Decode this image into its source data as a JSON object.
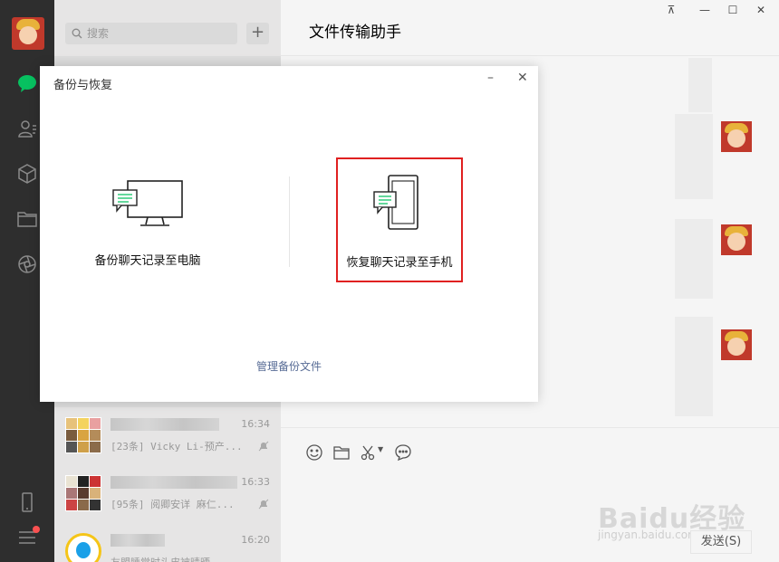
{
  "search": {
    "placeholder": "搜索"
  },
  "add_button": "+",
  "chat_title": "文件传输助手",
  "window_buttons": {
    "pin": "⊼",
    "minimize": "—",
    "maximize": "☐",
    "close": "✕"
  },
  "chat_list": [
    {
      "time": "16:34",
      "preview": "[23条] Vicky Li-预产..."
    },
    {
      "time": "16:33",
      "preview": "[95条] 阅卿安详  麻仁..."
    },
    {
      "time": "16:20",
      "preview": "友盟睡觉时头皮被晴晒..."
    }
  ],
  "dialog": {
    "title": "备份与恢复",
    "minimize": "–",
    "close": "✕",
    "backup_label": "备份聊天记录至电脑",
    "restore_label": "恢复聊天记录至手机",
    "manage_link": "管理备份文件"
  },
  "send_button": "发送(S)",
  "watermark": {
    "brand": "Baidu经验",
    "url": "jingyan.baidu.com"
  },
  "colors": {
    "accent_green": "#07c160",
    "highlight_red": "#e02020",
    "link_blue": "#576b95"
  }
}
